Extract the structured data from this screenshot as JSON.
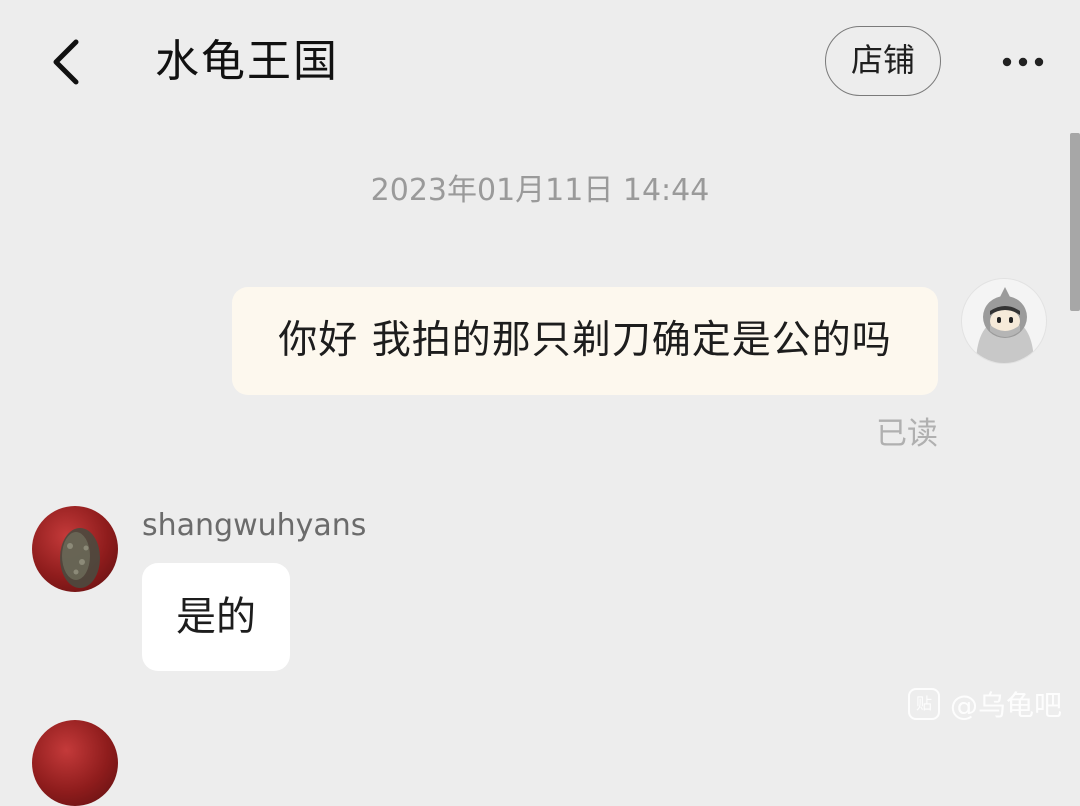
{
  "header": {
    "title": "水龟王国",
    "store_button": "店铺",
    "back_icon": "chevron-left-icon",
    "more_icon": "more-dots-icon"
  },
  "messages": {
    "timestamp": "2023年01月11日 14:44",
    "outgoing": {
      "text": "你好 我拍的那只剃刀确定是公的吗",
      "status": "已读"
    },
    "incoming": {
      "sender": "shangwuhyans",
      "text": "是的"
    }
  },
  "watermark": {
    "icon_text": "贴",
    "text": "@乌龟吧"
  },
  "colors": {
    "background": "#ededed",
    "outgoing_bubble": "#fdf8ee",
    "incoming_bubble": "#ffffff",
    "muted_text": "#9a9a9a"
  }
}
